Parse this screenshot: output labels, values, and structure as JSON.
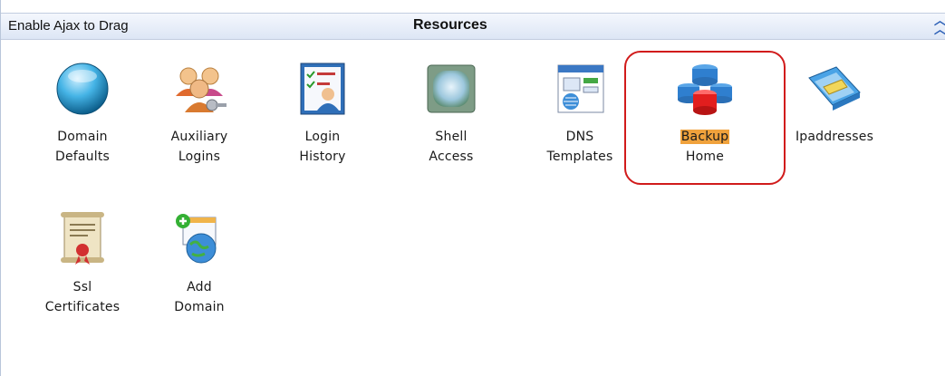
{
  "header": {
    "drag_label": "Enable Ajax to Drag",
    "title": "Resources",
    "collapse_icon": "double-chevron-up-icon"
  },
  "items": [
    {
      "line1": "Domain",
      "line2": "Defaults",
      "icon": "sphere-icon"
    },
    {
      "line1": "Auxiliary",
      "line2": "Logins",
      "icon": "users-key-icon"
    },
    {
      "line1": "Login",
      "line2": "History",
      "icon": "checklist-user-icon"
    },
    {
      "line1": "Shell",
      "line2": "Access",
      "icon": "shell-gem-icon"
    },
    {
      "line1": "DNS",
      "line2": "Templates",
      "icon": "dns-template-icon"
    },
    {
      "line1": "Backup",
      "line2": "Home",
      "icon": "database-stack-icon",
      "highlighted": true
    },
    {
      "line1": "Ipaddresses",
      "line2": "",
      "icon": "network-plug-icon"
    },
    {
      "line1": "Ssl",
      "line2": "Certificates",
      "icon": "certificate-icon"
    },
    {
      "line1": "Add",
      "line2": "Domain",
      "icon": "add-globe-icon"
    }
  ],
  "colors": {
    "highlight": "#f0a23c",
    "annotation_ring": "#d11b1b",
    "header_bg": "#dde6f5"
  }
}
